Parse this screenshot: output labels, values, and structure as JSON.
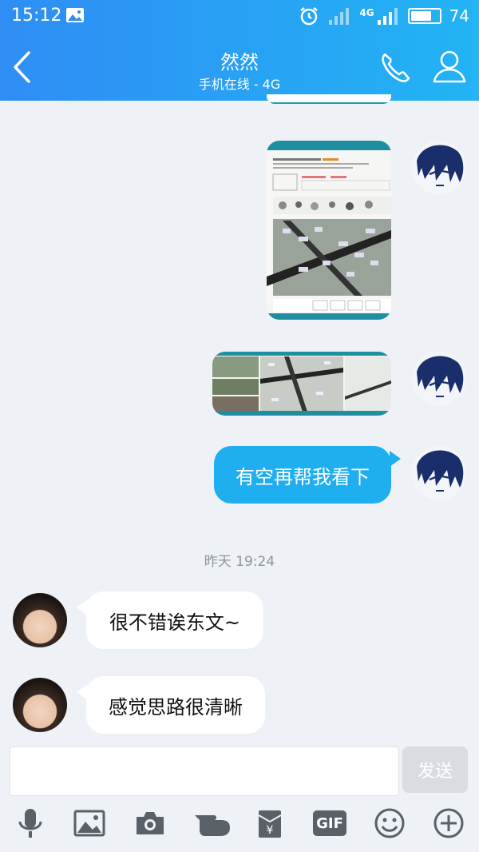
{
  "status_bar": {
    "time": "15:12",
    "network": "4G",
    "battery": "74",
    "battery_level": 0.74
  },
  "header": {
    "title": "然然",
    "subtitle": "手机在线 - 4G"
  },
  "messages": {
    "me_text": "有空再帮我看下",
    "timestamp": "昨天 19:24",
    "them_1": "很不错诶东文~",
    "them_2": "感觉思路很清晰"
  },
  "input": {
    "placeholder": "",
    "send_label": "发送"
  },
  "toolbar": {
    "gif_label": "GIF"
  },
  "colors": {
    "header_start": "#2f8df4",
    "header_end": "#22b4f4",
    "bubble_me": "#1faef0",
    "background": "#eef1f6"
  },
  "icons": [
    "back-icon",
    "phone-icon",
    "user-icon",
    "microphone-icon",
    "image-icon",
    "camera-icon",
    "hand-pointer-icon",
    "red-packet-icon",
    "gif-icon",
    "emoji-icon",
    "add-icon"
  ]
}
